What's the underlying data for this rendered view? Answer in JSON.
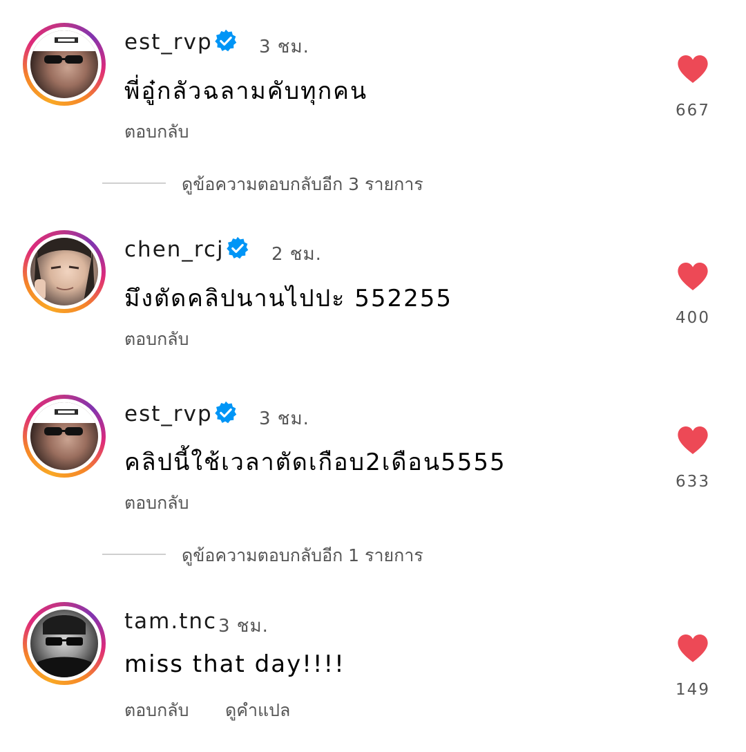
{
  "comments": [
    {
      "username": "est_rvp",
      "verified": true,
      "time": "3 ชม.",
      "text": "พี่อู๋กลัวฉลามคับทุกคน",
      "reply_label": "ตอบกลับ",
      "likes": "667",
      "avatar_icon": "profile-photo-swim-goggles"
    },
    {
      "username": "chen_rcj",
      "verified": true,
      "time": "2 ชม.",
      "text": "มึงตัดคลิปนานไปปะ 552255",
      "reply_label": "ตอบกลับ",
      "likes": "400",
      "avatar_icon": "profile-photo-anime"
    },
    {
      "username": "est_rvp",
      "verified": true,
      "time": "3 ชม.",
      "text": "คลิปนี้ใช้เวลาตัดเกือบ2เดือน5555",
      "reply_label": "ตอบกลับ",
      "likes": "633",
      "avatar_icon": "profile-photo-swim-goggles"
    },
    {
      "username": "tam.tnc",
      "verified": false,
      "time": "3 ชม.",
      "text": "miss that day!!!!",
      "reply_label": "ตอบกลับ",
      "translate_label": "ดูคำแปล",
      "likes": "149",
      "avatar_icon": "profile-photo-sunglasses-bw"
    }
  ],
  "view_more_replies": [
    "ดูข้อความตอบกลับอีก 3 รายการ",
    "ดูข้อความตอบกลับอีก 1 รายการ"
  ],
  "colors": {
    "heart": "#ed4956",
    "verified": "#0095f6",
    "secondary_text": "#555555",
    "ring_start": "#f9a825",
    "ring_end": "#c13584"
  },
  "icons": {
    "heart": "heart-filled-icon",
    "verified": "verified-badge-icon"
  }
}
